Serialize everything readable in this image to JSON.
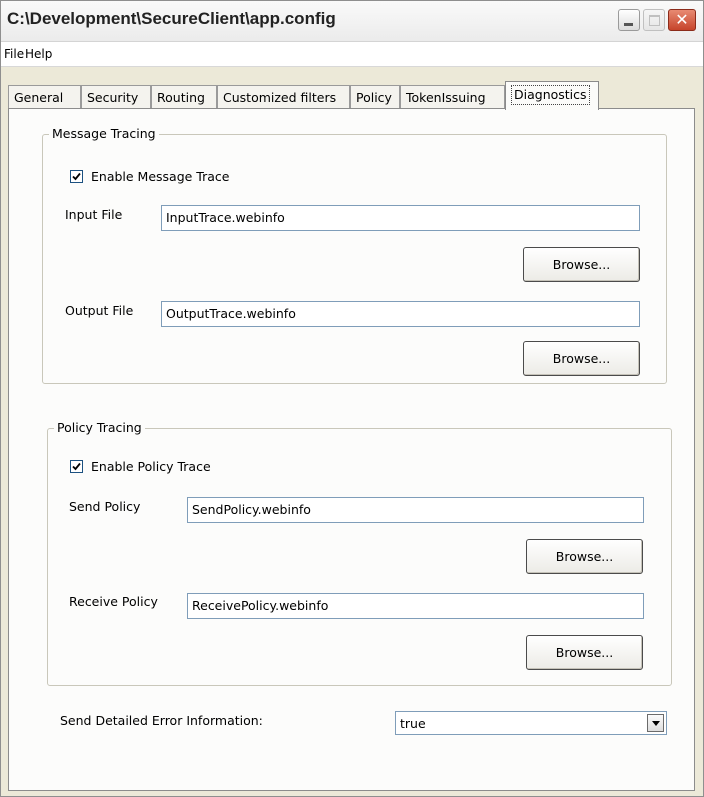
{
  "window": {
    "title": "C:\\Development\\SecureClient\\app.config",
    "close_glyph": "✕"
  },
  "menu": {
    "items": [
      {
        "label": "File"
      },
      {
        "label": "Help"
      }
    ]
  },
  "tabs": [
    {
      "label": "General"
    },
    {
      "label": "Security"
    },
    {
      "label": "Routing"
    },
    {
      "label": "Customized filters"
    },
    {
      "label": "Policy"
    },
    {
      "label": "TokenIssuing"
    },
    {
      "label": "Diagnostics",
      "active": true
    }
  ],
  "message_tracing": {
    "legend": "Message Tracing",
    "enable_label": "Enable Message Trace",
    "enabled": true,
    "input_label": "Input File",
    "input_value": "InputTrace.webinfo",
    "output_label": "Output File",
    "output_value": "OutputTrace.webinfo",
    "browse_label": "Browse..."
  },
  "policy_tracing": {
    "legend": "Policy Tracing",
    "enable_label": "Enable Policy Trace",
    "enabled": true,
    "send_label": "Send Policy",
    "send_value": "SendPolicy.webinfo",
    "receive_label": "Receive Policy",
    "receive_value": "ReceivePolicy.webinfo",
    "browse_label": "Browse..."
  },
  "error_info": {
    "label": "Send Detailed Error Information:",
    "value": "true"
  }
}
